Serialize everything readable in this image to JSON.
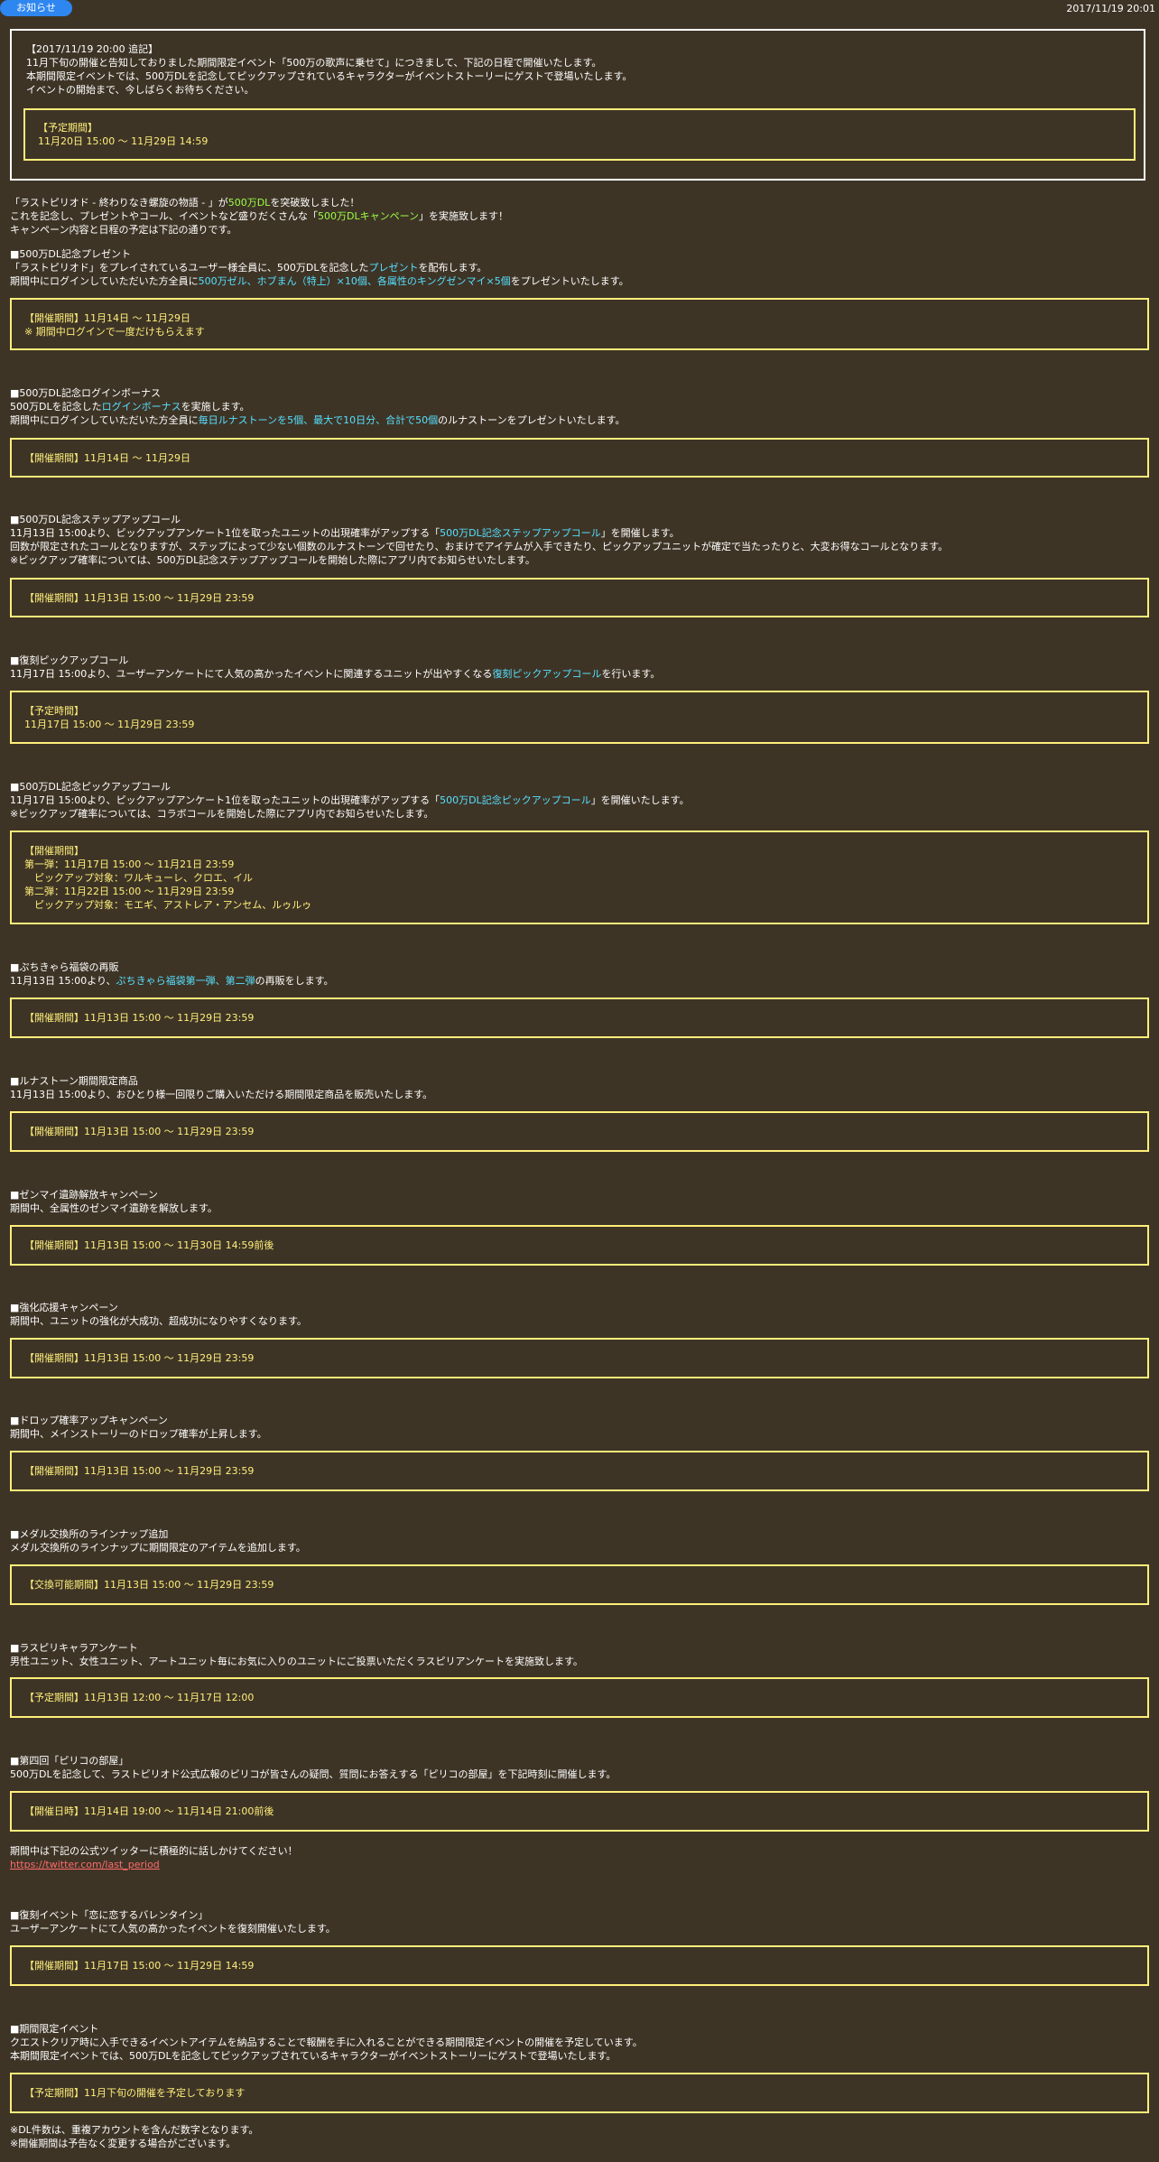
{
  "header": {
    "badge": "お知らせ",
    "date": "2017/11/19 20:01"
  },
  "notice": {
    "lines": [
      "【2017/11/19 20:00 追記】",
      "11月下旬の開催と告知しておりました期間限定イベント「500万の歌声に乗せて」につきまして、下記の日程で開催いたします。",
      "本期間限定イベントでは、500万DLを記念してピックアップされているキャラクターがイベントストーリーにゲストで登場いたします。",
      "イベントの開始まで、今しばらくお待ちください。"
    ],
    "box": [
      "【予定期間】",
      "11月20日 15:00 ～ 11月29日 14:59"
    ]
  },
  "intro": {
    "l1a": "「ラストピリオド - 終わりなき螺旋の物語 - 」が",
    "l1b": "500万DL",
    "l1c": "を突破致しました！",
    "l2a": "これを記念し、プレゼントやコール、イベントなど盛りだくさんな「",
    "l2b": "500万DLキャンペーン",
    "l2c": "」を実施致します！",
    "l3": "キャンペーン内容と日程の予定は下記の通りです。"
  },
  "present": {
    "title": "■500万DL記念プレゼント",
    "l1a": "「ラストピリオド」をプレイされているユーザー様全員に、500万DLを記念した",
    "l1b": "プレゼント",
    "l1c": "を配布します。",
    "l2a": "期間中にログインしていただいた方全員に",
    "l2b": "500万ゼル、ホブまん（特上）×10個、各属性のキングゼンマイ×5個",
    "l2c": "をプレゼントいたします。",
    "box": [
      "【開催期間】11月14日 ～ 11月29日",
      "※ 期間中ログインで一度だけもらえます"
    ]
  },
  "login": {
    "title": "■500万DL記念ログインボーナス",
    "l1a": "500万DLを記念した",
    "l1b": "ログインボーナス",
    "l1c": "を実施します。",
    "l2a": "期間中にログインしていただいた方全員に",
    "l2b": "毎日ルナストーンを5個、最大で10日分、合計で50個",
    "l2c": "のルナストーンをプレゼントいたします。",
    "box": "【開催期間】11月14日 ～ 11月29日"
  },
  "stepup": {
    "title": "■500万DL記念ステップアップコール",
    "l1a": "11月13日 15:00より、ピックアップアンケート1位を取ったユニットの出現確率がアップする「",
    "l1b": "500万DL記念ステップアップコール",
    "l1c": "」を開催します。",
    "l2": "回数が限定されたコールとなりますが、ステップによって少ない個数のルナストーンで回せたり、おまけでアイテムが入手できたり、ピックアップユニットが確定で当たったりと、大変お得なコールとなります。",
    "l3": "※ピックアップ確率については、500万DL記念ステップアップコールを開始した際にアプリ内でお知らせいたします。",
    "box": "【開催期間】11月13日 15:00 ～ 11月29日 23:59"
  },
  "revival": {
    "title": "■復刻ピックアップコール",
    "l1a": "11月17日 15:00より、ユーザーアンケートにて人気の高かったイベントに関連するユニットが出やすくなる",
    "l1b": "復刻ピックアップコール",
    "l1c": "を行います。",
    "box": [
      "【予定時間】",
      "11月17日 15:00 ～ 11月29日 23:59"
    ]
  },
  "pickup": {
    "title": "■500万DL記念ピックアップコール",
    "l1a": "11月17日 15:00より、ピックアップアンケート1位を取ったユニットの出現確率がアップする「",
    "l1b": "500万DL記念ピックアップコール",
    "l1c": "」を開催いたします。",
    "l2": "※ピックアップ確率については、コラボコールを開始した際にアプリ内でお知らせいたします。",
    "box": [
      "【開催期間】",
      "第一弾：11月17日 15:00 ～ 11月21日 23:59",
      "　ピックアップ対象：ワルキューレ、クロエ、イル",
      "第二弾：11月22日 15:00 ～ 11月29日 23:59",
      "　ピックアップ対象：モエギ、アストレア・アンセム、ルゥルゥ"
    ]
  },
  "luckybag": {
    "title": "■ぷちきゃら福袋の再販",
    "l1a": "11月13日 15:00より、",
    "l1b": "ぷちきゃら福袋第一弾、第二弾",
    "l1c": "の再販をします。",
    "box": "【開催期間】11月13日 15:00 ～ 11月29日 23:59"
  },
  "limited": {
    "title": "■ルナストーン期間限定商品",
    "l1": "11月13日 15:00より、おひとり様一回限りご購入いただける期間限定商品を販売いたします。",
    "box": "【開催期間】11月13日 15:00 ～ 11月29日 23:59"
  },
  "zenmai": {
    "title": "■ゼンマイ遺跡解放キャンペーン",
    "l1": "期間中、全属性のゼンマイ遺跡を解放します。",
    "box": "【開催期間】11月13日 15:00 ～ 11月30日 14:59前後"
  },
  "enhance": {
    "title": "■強化応援キャンペーン",
    "l1": "期間中、ユニットの強化が大成功、超成功になりやすくなります。",
    "box": "【開催期間】11月13日 15:00 ～ 11月29日 23:59"
  },
  "drop": {
    "title": "■ドロップ確率アップキャンペーン",
    "l1": "期間中、メインストーリーのドロップ確率が上昇します。",
    "box": "【開催期間】11月13日 15:00 ～ 11月29日 23:59"
  },
  "medal": {
    "title": "■メダル交換所のラインナップ追加",
    "l1": "メダル交換所のラインナップに期間限定のアイテムを追加します。",
    "box": "【交換可能期間】11月13日 15:00 ～ 11月29日 23:59"
  },
  "survey": {
    "title": "■ラスピリキャラアンケート",
    "l1": "男性ユニット、女性ユニット、アートユニット毎にお気に入りのユニットにご投票いただくラスピリアンケートを実施致します。",
    "box": "【予定期間】11月13日 12:00 ～ 11月17日 12:00"
  },
  "piriko": {
    "title": "■第四回「ピリコの部屋」",
    "l1": "500万DLを記念して、ラストピリオド公式広報のピリコが皆さんの疑問、質問にお答えする「ピリコの部屋」を下記時刻に開催します。",
    "box": "【開催日時】11月14日 19:00 ～ 11月14日 21:00前後",
    "after": "期間中は下記の公式ツイッターに積極的に話しかけてください！",
    "link": "https://twitter.com/last_period"
  },
  "valentine": {
    "title": "■復刻イベント「恋に恋するバレンタイン」",
    "l1": "ユーザーアンケートにて人気の高かったイベントを復刻開催いたします。",
    "box": "【開催期間】11月17日 15:00 ～ 11月29日 14:59"
  },
  "event": {
    "title": "■期間限定イベント",
    "l1": "クエストクリア時に入手できるイベントアイテムを納品することで報酬を手に入れることができる期間限定イベントの開催を予定しています。",
    "l2": "本期間限定イベントでは、500万DLを記念してピックアップされているキャラクターがイベントストーリーにゲストで登場いたします。",
    "box": "【予定期間】11月下旬の開催を予定しております"
  },
  "footer": {
    "l1": "※DL件数は、重複アカウントを含んだ数字となります。",
    "l2": "※開催期間は予告なく変更する場合がございます。"
  }
}
